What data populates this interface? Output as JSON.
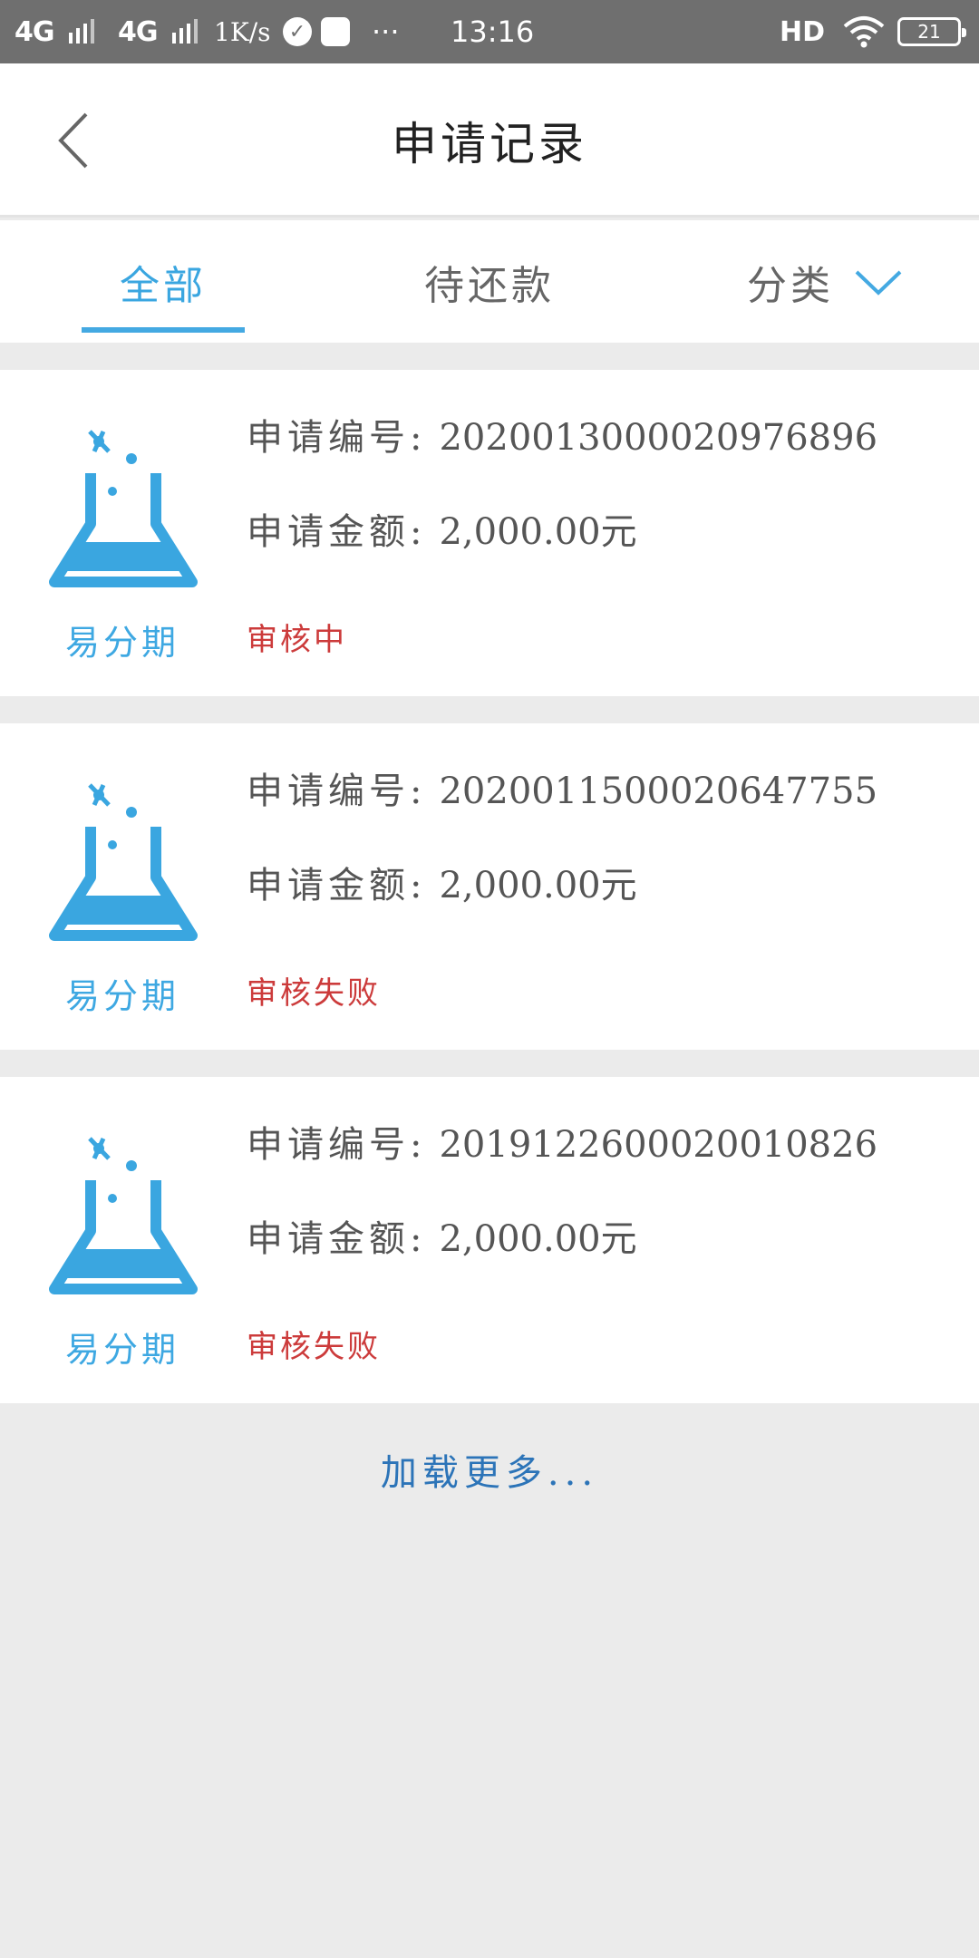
{
  "status_bar": {
    "net1": "4G",
    "net2": "4G",
    "speed": "1K/s",
    "more": "···",
    "time": "13:16",
    "hd": "HD",
    "battery": "21"
  },
  "header": {
    "title": "申请记录",
    "back_icon": "chevron-left-icon"
  },
  "tabs": [
    {
      "label": "全部",
      "active": true
    },
    {
      "label": "待还款",
      "active": false
    },
    {
      "label": "分类",
      "active": false,
      "icon": "chevron-down-icon"
    }
  ],
  "colors": {
    "accent": "#3aa6e0",
    "status_red": "#cc3b3b",
    "link_blue": "#2c74b8",
    "background": "#ebebeb"
  },
  "records": [
    {
      "brand": "易分期",
      "id_label": "申请编号:",
      "id_value": "2020013000020976896",
      "amount_label": "申请金额:",
      "amount_value": "2,000.00元",
      "status": "审核中"
    },
    {
      "brand": "易分期",
      "id_label": "申请编号:",
      "id_value": "2020011500020647755",
      "amount_label": "申请金额:",
      "amount_value": "2,000.00元",
      "status": "审核失败"
    },
    {
      "brand": "易分期",
      "id_label": "申请编号:",
      "id_value": "2019122600020010826",
      "amount_label": "申请金额:",
      "amount_value": "2,000.00元",
      "status": "审核失败"
    }
  ],
  "load_more": "加载更多..."
}
